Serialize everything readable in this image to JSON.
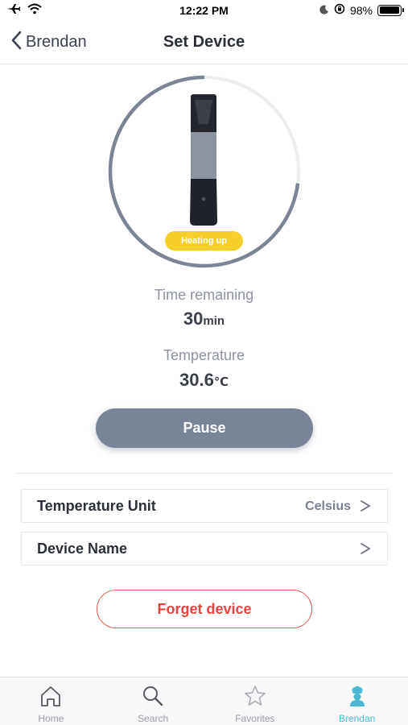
{
  "status_bar": {
    "time": "12:22 PM",
    "battery": "98%"
  },
  "nav": {
    "back_label": "Brendan",
    "title": "Set Device"
  },
  "device": {
    "status_badge": "Heating up",
    "progress_fraction": 0.27
  },
  "time_remaining": {
    "label": "Time remaining",
    "value": "30",
    "unit": "min"
  },
  "temperature": {
    "label": "Temperature",
    "value": "30.6",
    "unit": "℃"
  },
  "pause_label": "Pause",
  "settings": [
    {
      "label": "Temperature Unit",
      "value": "Celsius"
    },
    {
      "label": "Device Name",
      "value": ""
    }
  ],
  "forget_label": "Forget device",
  "tabs": [
    {
      "label": "Home",
      "icon": "home-icon"
    },
    {
      "label": "Search",
      "icon": "search-icon"
    },
    {
      "label": "Favorites",
      "icon": "star-icon"
    },
    {
      "label": "Brendan",
      "icon": "chef-icon",
      "active": true
    }
  ],
  "colors": {
    "accent": "#4cb8d4",
    "badge": "#f6cf2b",
    "danger": "#e4463f",
    "button": "#7a8497"
  }
}
